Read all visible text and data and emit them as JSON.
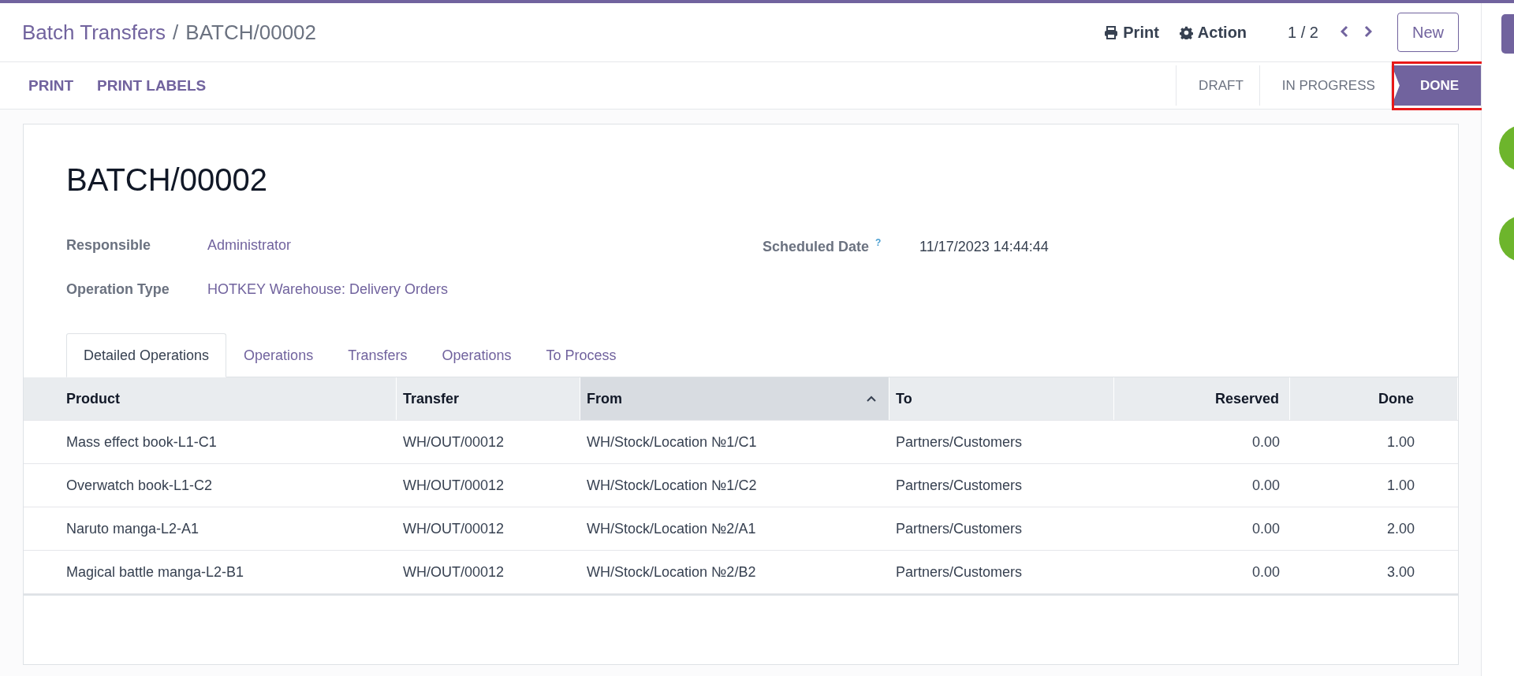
{
  "breadcrumb": {
    "parent": "Batch Transfers",
    "separator": "/",
    "current": "BATCH/00002"
  },
  "header_actions": [
    {
      "kind": "print",
      "label": "Print"
    },
    {
      "kind": "gear",
      "label": "Action"
    }
  ],
  "pager": {
    "value": "1 / 2"
  },
  "new_button": "New",
  "control_buttons": [
    "PRINT",
    "PRINT LABELS"
  ],
  "status_stages": [
    {
      "label": "DRAFT",
      "selected": false
    },
    {
      "label": "IN PROGRESS",
      "selected": false
    },
    {
      "label": "DONE",
      "selected": true
    }
  ],
  "record": {
    "title": "BATCH/00002",
    "left_fields": [
      {
        "label": "Responsible",
        "value": "Administrator"
      },
      {
        "label": "Operation Type",
        "value": "HOTKEY Warehouse: Delivery Orders"
      }
    ],
    "right_fields": [
      {
        "label": "Scheduled Date",
        "help": "?",
        "value": "11/17/2023 14:44:44"
      }
    ]
  },
  "tabs": [
    {
      "label": "Detailed Operations",
      "selected": true
    },
    {
      "label": "Operations",
      "selected": false
    },
    {
      "label": "Transfers",
      "selected": false
    },
    {
      "label": "Operations",
      "selected": false
    },
    {
      "label": "To Process",
      "selected": false
    }
  ],
  "table": {
    "columns": [
      {
        "label": "Product",
        "kind": "text",
        "sorted": false
      },
      {
        "label": "Transfer",
        "kind": "text",
        "sorted": false
      },
      {
        "label": "From",
        "kind": "text",
        "sorted": true
      },
      {
        "label": "To",
        "kind": "text",
        "sorted": false
      },
      {
        "label": "Reserved",
        "kind": "number",
        "sorted": false
      },
      {
        "label": "Done",
        "kind": "number",
        "sorted": false
      }
    ],
    "rows": [
      [
        "Mass effect book-L1-C1",
        "WH/OUT/00012",
        "WH/Stock/Location №1/C1",
        "Partners/Customers",
        "0.00",
        "1.00"
      ],
      [
        "Overwatch book-L1-C2",
        "WH/OUT/00012",
        "WH/Stock/Location №1/C2",
        "Partners/Customers",
        "0.00",
        "1.00"
      ],
      [
        "Naruto manga-L2-A1",
        "WH/OUT/00012",
        "WH/Stock/Location №2/A1",
        "Partners/Customers",
        "0.00",
        "2.00"
      ],
      [
        "Magical battle manga-L2-B1",
        "WH/OUT/00012",
        "WH/Stock/Location №2/B2",
        "Partners/Customers",
        "0.00",
        "3.00"
      ]
    ]
  }
}
